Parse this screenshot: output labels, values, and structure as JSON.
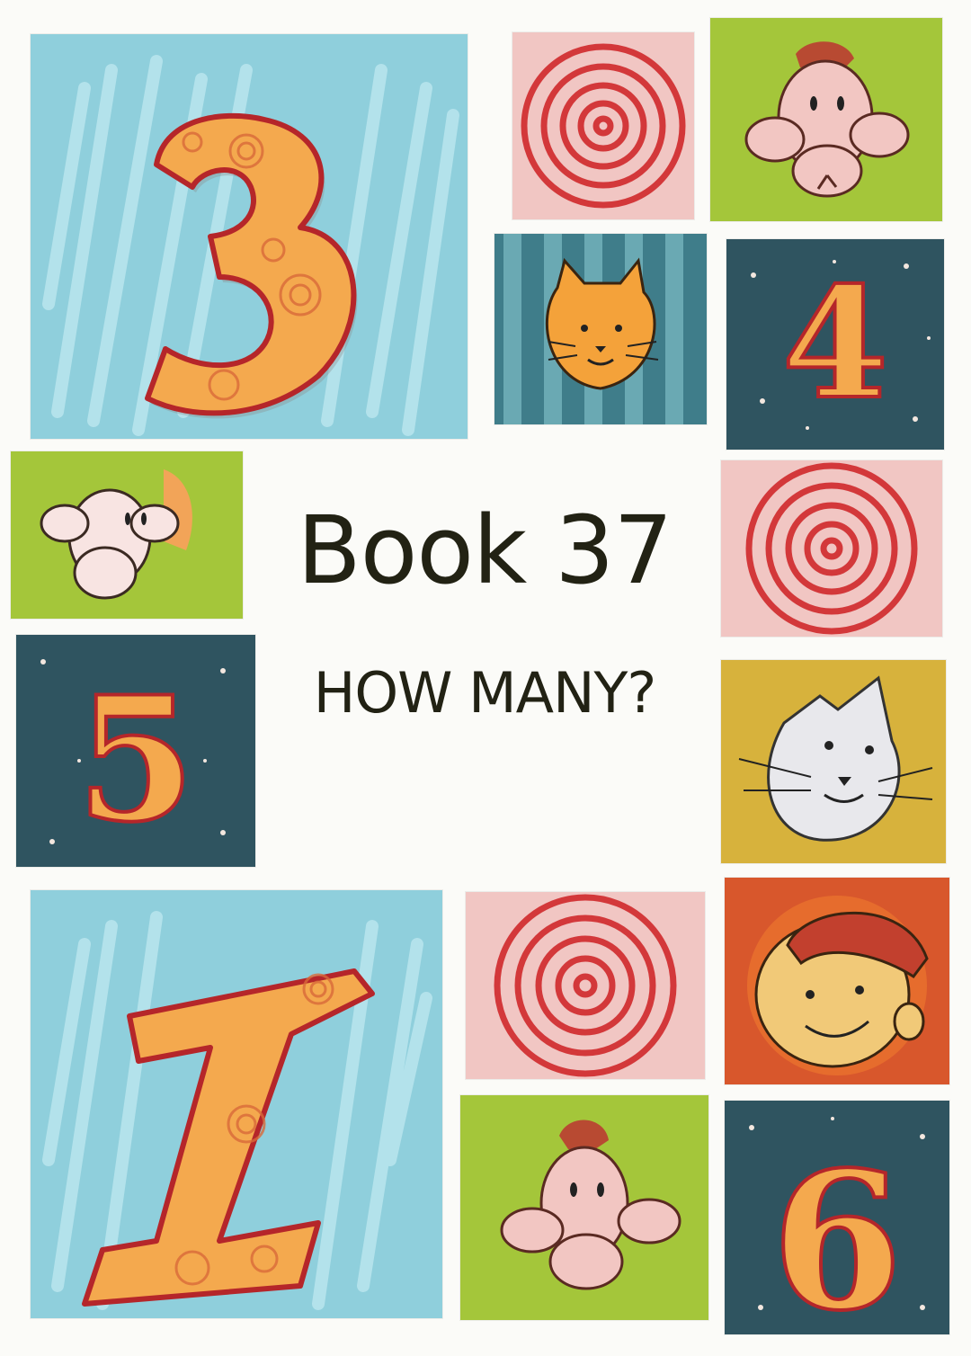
{
  "cover": {
    "title": "Book 37",
    "subtitle": "HOW MANY?"
  },
  "tiles": {
    "three": {
      "numeral": "3"
    },
    "four": {
      "numeral": "4"
    },
    "five": {
      "numeral": "5"
    },
    "one": {
      "numeral": "1"
    },
    "six": {
      "numeral": "6"
    }
  },
  "icons": [
    "big-number-3-icon",
    "spiral-icon",
    "monkey-face-icon",
    "orange-cat-face-icon",
    "number-4-icon",
    "number-5-icon",
    "grey-cat-face-icon",
    "big-number-1-icon",
    "girl-face-icon",
    "number-6-icon"
  ],
  "colors": {
    "sky_blue": "#8fcfdc",
    "lime_green": "#a4c63a",
    "night_teal": "#2f5460",
    "spiral_red": "#d3383a",
    "spiral_pink": "#f1c6c3",
    "number_orange": "#f4a94e",
    "outline_red": "#b5262a",
    "title_ink": "#222214"
  }
}
